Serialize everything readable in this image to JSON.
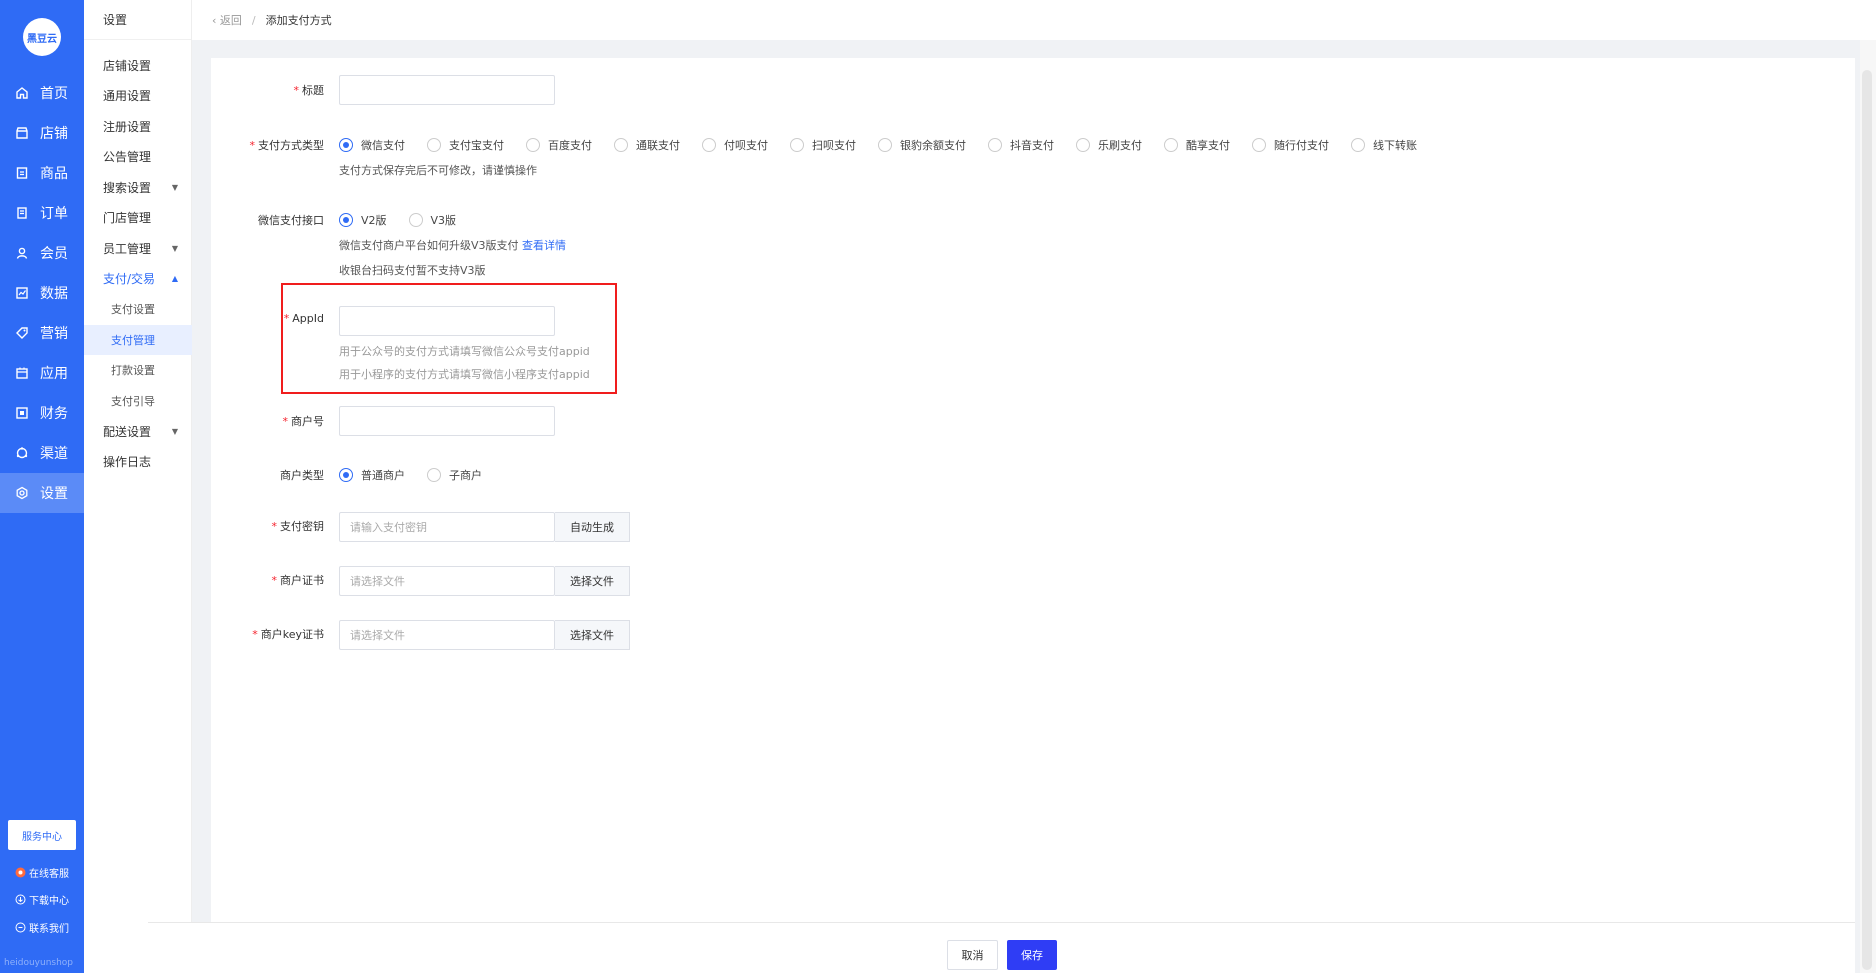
{
  "app": {
    "logo_text": "黑豆云",
    "footer_text": "heidouyunshop"
  },
  "nav": {
    "items": [
      {
        "label": "首页",
        "icon": "home-icon"
      },
      {
        "label": "店铺",
        "icon": "store-icon"
      },
      {
        "label": "商品",
        "icon": "goods-icon"
      },
      {
        "label": "订单",
        "icon": "order-icon"
      },
      {
        "label": "会员",
        "icon": "member-icon"
      },
      {
        "label": "数据",
        "icon": "chart-icon"
      },
      {
        "label": "营销",
        "icon": "tag-icon"
      },
      {
        "label": "应用",
        "icon": "app-icon"
      },
      {
        "label": "财务",
        "icon": "finance-icon"
      },
      {
        "label": "渠道",
        "icon": "channel-icon"
      },
      {
        "label": "设置",
        "icon": "gear-icon"
      }
    ],
    "active_index": 10,
    "service_center": "服务中心",
    "online_service": "在线客服",
    "download_center": "下载中心",
    "contact_us": "联系我们"
  },
  "side": {
    "title": "设置",
    "items": [
      {
        "label": "店铺设置"
      },
      {
        "label": "通用设置"
      },
      {
        "label": "注册设置"
      },
      {
        "label": "公告管理"
      },
      {
        "label": "搜索设置",
        "caret": "▼"
      },
      {
        "label": "门店管理"
      },
      {
        "label": "员工管理",
        "caret": "▼"
      },
      {
        "label": "支付/交易",
        "caret": "▲"
      },
      {
        "label": "支付设置"
      },
      {
        "label": "支付管理"
      },
      {
        "label": "打款设置"
      },
      {
        "label": "支付引导"
      },
      {
        "label": "配送设置",
        "caret": "▼"
      },
      {
        "label": "操作日志"
      }
    ]
  },
  "breadcrumb": {
    "back": "返回",
    "sep": "/",
    "current": "添加支付方式"
  },
  "form": {
    "req_mark": "*",
    "title_label": "标题",
    "title_value": "",
    "pay_type_label": "支付方式类型",
    "pay_types": [
      "微信支付",
      "支付宝支付",
      "百度支付",
      "通联支付",
      "付呗支付",
      "扫呗支付",
      "银豹余额支付",
      "抖音支付",
      "乐刷支付",
      "酷享支付",
      "随行付支付",
      "线下转账"
    ],
    "pay_type_selected": 0,
    "pay_type_tip": "支付方式保存完后不可修改，请谨慎操作",
    "wx_api_label": "微信支付接口",
    "wx_api_options": [
      "V2版",
      "V3版"
    ],
    "wx_api_selected": 0,
    "wx_api_tip": "微信支付商户平台如何升级V3版支付",
    "wx_api_tip_link": "查看详情",
    "wx_api_tip2": "收银台扫码支付暂不支持V3版",
    "appid_label": "AppId",
    "appid_value": "",
    "appid_tip1": "用于公众号的支付方式请填写微信公众号支付appid",
    "appid_tip2": "用于小程序的支付方式请填写微信小程序支付appid",
    "merchant_no_label": "商户号",
    "merchant_no_value": "",
    "merchant_type_label": "商户类型",
    "merchant_types": [
      "普通商户",
      "子商户"
    ],
    "merchant_type_selected": 0,
    "pay_key_label": "支付密钥",
    "pay_key_placeholder": "请输入支付密钥",
    "pay_key_btn": "自动生成",
    "cert_label": "商户证书",
    "cert_placeholder": "请选择文件",
    "cert_btn": "选择文件",
    "key_cert_label": "商户key证书",
    "key_cert_placeholder": "请选择文件",
    "key_cert_btn": "选择文件"
  },
  "footer": {
    "cancel": "取消",
    "save": "保存"
  },
  "colors": {
    "primary": "#2f6bf5",
    "save_button": "#2f3df5",
    "required": "#f5222d",
    "highlight": "#f01d1d"
  }
}
